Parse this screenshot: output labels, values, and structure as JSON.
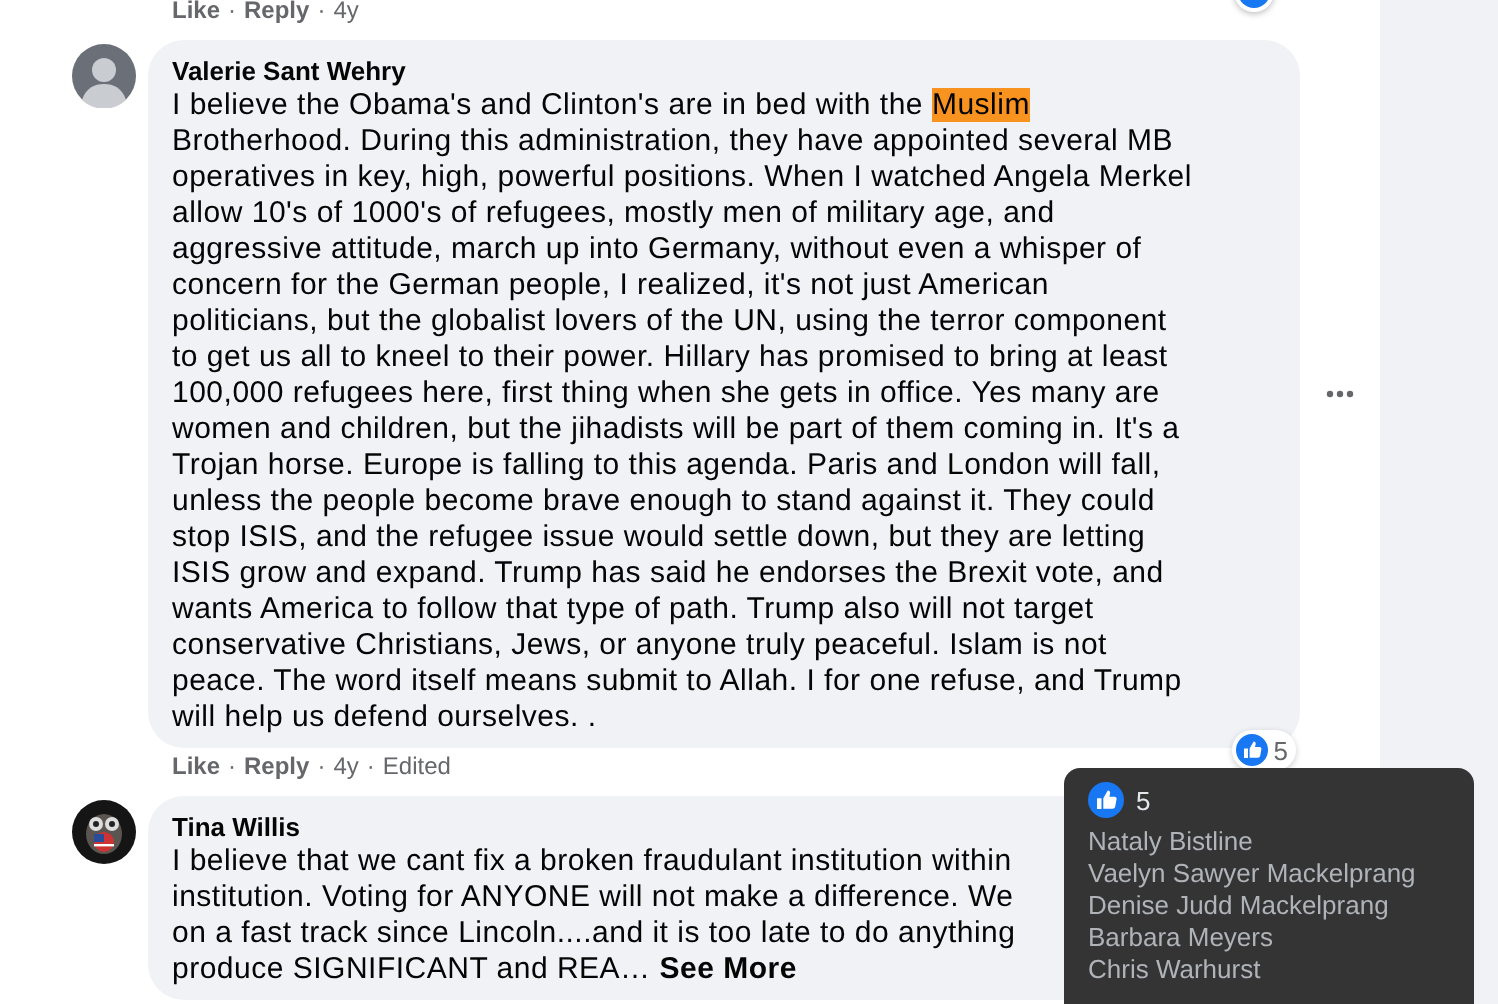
{
  "previous_comment": {
    "actions": [
      {
        "kind": "link",
        "text": "Like"
      },
      {
        "kind": "link",
        "text": "Reply"
      },
      {
        "kind": "meta",
        "text": "4y"
      }
    ],
    "separator": "·"
  },
  "comments": [
    {
      "author": "Valerie Sant Wehry",
      "avatar": {
        "kind": "person"
      },
      "runs": [
        {
          "text": "I believe the Obama's and Clinton's are in bed with the ",
          "highlighted": false
        },
        {
          "text": "Muslim",
          "highlighted": true
        },
        {
          "text": "\nBrotherhood. During this administration, they have appointed several MB\noperatives in key, high, powerful positions. When I watched Angela Merkel\nallow 10's of 1000's of refugees, mostly men of military age, and\naggressive attitude, march up into Germany, without even a whisper of\nconcern for the German people, I realized, it's not just American\npoliticians, but the globalist lovers of the UN, using the terror component\nto get us all to kneel to their power. Hillary has promised to bring at least\n100,000 refugees here, first thing when she gets in office. Yes many are\nwomen and children, but the jihadists will be part of them coming in. It's a\nTrojan horse. Europe is falling to this agenda. Paris and London will fall,\nunless the people become brave enough to stand against it. They could\nstop ISIS, and the refugee issue would settle down, but they are letting\nISIS grow and expand. Trump has said he endorses the Brexit vote, and\nwants America to follow that type of path. Trump also will not target\nconservative Christians, Jews, or anyone truly peaceful. Islam is not\npeace. The word itself means submit to Allah. I for one refuse, and Trump\nwill help us defend ourselves. .",
          "highlighted": false
        }
      ],
      "reaction_count": "5",
      "has_menu": true,
      "actions": [
        {
          "kind": "link",
          "text": "Like"
        },
        {
          "kind": "link",
          "text": "Reply"
        },
        {
          "kind": "meta",
          "text": "4y"
        },
        {
          "kind": "meta",
          "text": "Edited"
        }
      ],
      "separator": "·"
    },
    {
      "author": "Tina Willis",
      "avatar": {
        "kind": "owl"
      },
      "runs": [
        {
          "text": "I believe that we cant fix a broken fraudulant institution within\ninstitution. Voting for ANYONE will not make a difference. We\non a fast track since Lincoln....and it is too late to do anything\nproduce SIGNIFICANT and REA… ",
          "highlighted": false
        }
      ],
      "see_more": "See More",
      "has_menu": false
    }
  ],
  "reaction_tooltip": {
    "count": "5",
    "names": [
      "Nataly Bistline",
      "Vaelyn Sawyer Mackelprang",
      "Denise Judd Mackelprang",
      "Barbara Meyers",
      "Chris Warhurst"
    ]
  }
}
